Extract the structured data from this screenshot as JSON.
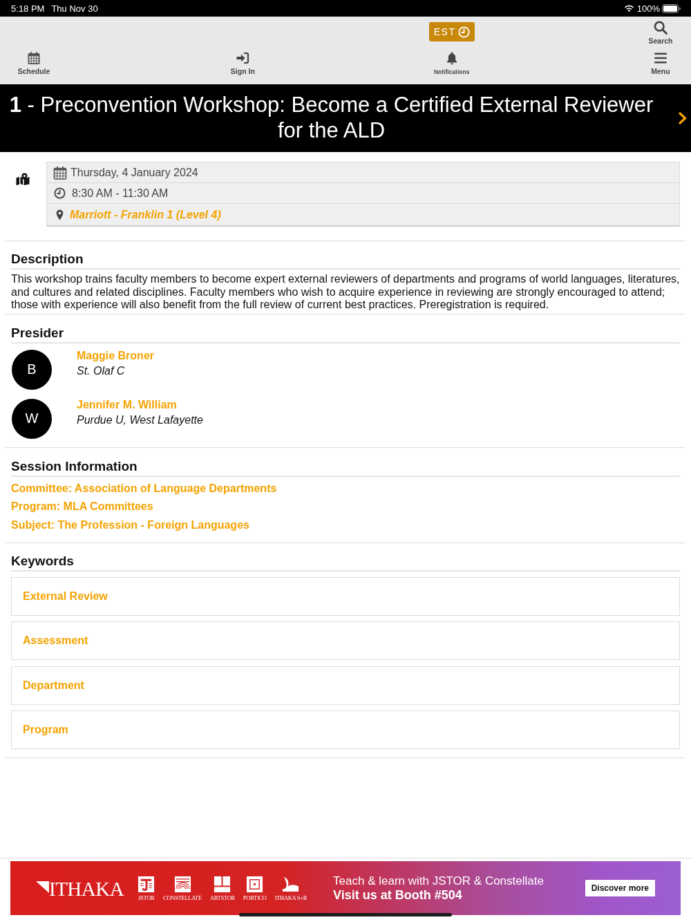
{
  "status_bar": {
    "time": "5:18 PM",
    "date": "Thu Nov 30",
    "battery": "100%"
  },
  "toolbar": {
    "timezone": "EST",
    "search": "Search",
    "items": [
      {
        "kind": "schedule",
        "label": "Schedule"
      },
      {
        "kind": "signin",
        "label": "Sign In"
      },
      {
        "kind": "notifications",
        "label": "Notifications"
      },
      {
        "kind": "menu",
        "label": "Menu"
      }
    ]
  },
  "title_bar": {
    "title": "**1** - Preconvention Workshop: Become a Certified External Reviewer for the ALD"
  },
  "details": {
    "date": "Thursday, 4 January 2024",
    "time": "8:30 AM - 11:30 AM",
    "location": "Marriott - Franklin 1 (Level 4)"
  },
  "description": {
    "heading": "Description",
    "text": "This workshop trains faculty members to become expert external reviewers of departments and programs of world languages, literatures, and cultures and related disciplines. Faculty members who wish to acquire experience in reviewing are strongly encouraged to attend; those with experience will also benefit from the full review of current best practices. Preregistration is required."
  },
  "presiders": {
    "heading": "Presider",
    "people": [
      {
        "initial": "B",
        "name": "Maggie Broner",
        "affiliation": "St. Olaf C"
      },
      {
        "initial": "W",
        "name": "Jennifer M. William",
        "affiliation": "Purdue U, West Lafayette"
      }
    ]
  },
  "session_information": {
    "heading": "Session Information",
    "links": [
      "Committee: Association of Language Departments",
      "Program: MLA Committees",
      "Subject: The Profession - Foreign Languages"
    ]
  },
  "keywords": {
    "heading": "Keywords",
    "items": [
      "External Review",
      "Assessment",
      "Department",
      "Program"
    ]
  },
  "ad": {
    "logo": "ITHAKA",
    "brands": [
      {
        "kind": "jstor",
        "name": "JSTOR"
      },
      {
        "kind": "constellate",
        "name": "CONSTELLATE"
      },
      {
        "kind": "artstor",
        "name": "ARTSTOR"
      },
      {
        "kind": "portico",
        "name": "PORTICO"
      },
      {
        "kind": "sr",
        "name": "ITHAKA S+R"
      }
    ],
    "headline": "Teach & learn with JSTOR & Constellate",
    "subline": "Visit us at Booth #504",
    "button": "Discover more"
  }
}
